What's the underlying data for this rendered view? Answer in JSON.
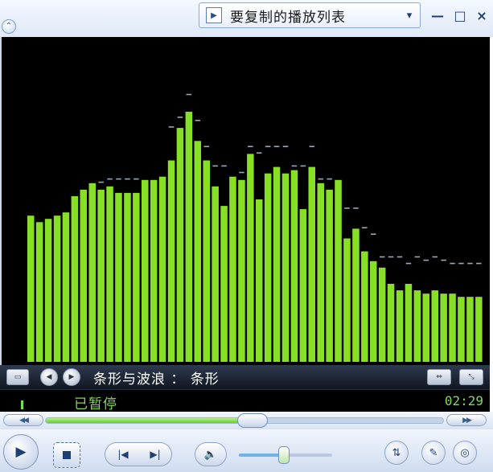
{
  "header": {
    "playlist_label": "要复制的播放列表",
    "nav_icon": "chevron-icon",
    "playlist_icon": "play-icon",
    "dropdown_icon": "chevron-down-icon",
    "minimize_glyph": "—",
    "maximize_glyph": "□",
    "close_glyph": "×"
  },
  "visualization": {
    "name": "条形与波浪 ： 条形",
    "bar_color": "#88e026",
    "peak_color": "#9aa8b8",
    "levels": [
      0.45,
      0.43,
      0.44,
      0.45,
      0.46,
      0.51,
      0.53,
      0.55,
      0.53,
      0.54,
      0.52,
      0.52,
      0.52,
      0.56,
      0.56,
      0.57,
      0.62,
      0.72,
      0.77,
      0.68,
      0.62,
      0.54,
      0.48,
      0.57,
      0.56,
      0.64,
      0.5,
      0.58,
      0.6,
      0.58,
      0.59,
      0.47,
      0.6,
      0.55,
      0.53,
      0.56,
      0.38,
      0.41,
      0.34,
      0.31,
      0.29,
      0.24,
      0.22,
      0.24,
      0.22,
      0.21,
      0.22,
      0.21,
      0.21,
      0.2,
      0.2,
      0.2
    ],
    "peaks": [
      0.45,
      0.43,
      0.44,
      0.45,
      0.46,
      0.51,
      0.53,
      0.55,
      0.55,
      0.56,
      0.56,
      0.56,
      0.56,
      0.56,
      0.56,
      0.57,
      0.72,
      0.75,
      0.82,
      0.74,
      0.66,
      0.6,
      0.6,
      0.57,
      0.58,
      0.66,
      0.64,
      0.66,
      0.66,
      0.66,
      0.6,
      0.6,
      0.66,
      0.56,
      0.56,
      0.56,
      0.47,
      0.47,
      0.41,
      0.39,
      0.32,
      0.32,
      0.32,
      0.3,
      0.32,
      0.31,
      0.32,
      0.31,
      0.3,
      0.3,
      0.3,
      0.3
    ]
  },
  "controls": {
    "status": "已暂停",
    "time": "02:29",
    "seek_progress": 0.52,
    "volume_level": 0.48,
    "pause_icon": "pause-icon",
    "fullscreen_icon": "screen-icon",
    "prev_viz_icon": "arrow-left-icon",
    "next_viz_icon": "arrow-right-icon",
    "resize_icon": "resize-icon",
    "minimize_icon": "mini-view-icon",
    "rewind_glyph": "◀◀",
    "forward_glyph": "▶▶",
    "play_glyph": "▶",
    "prev_glyph": "|◀",
    "next_glyph": "▶|",
    "volume_glyph": "🔈",
    "eq_icon": "equalizer-icon",
    "pen_icon": "pen-icon",
    "disc_icon": "disc-icon"
  }
}
